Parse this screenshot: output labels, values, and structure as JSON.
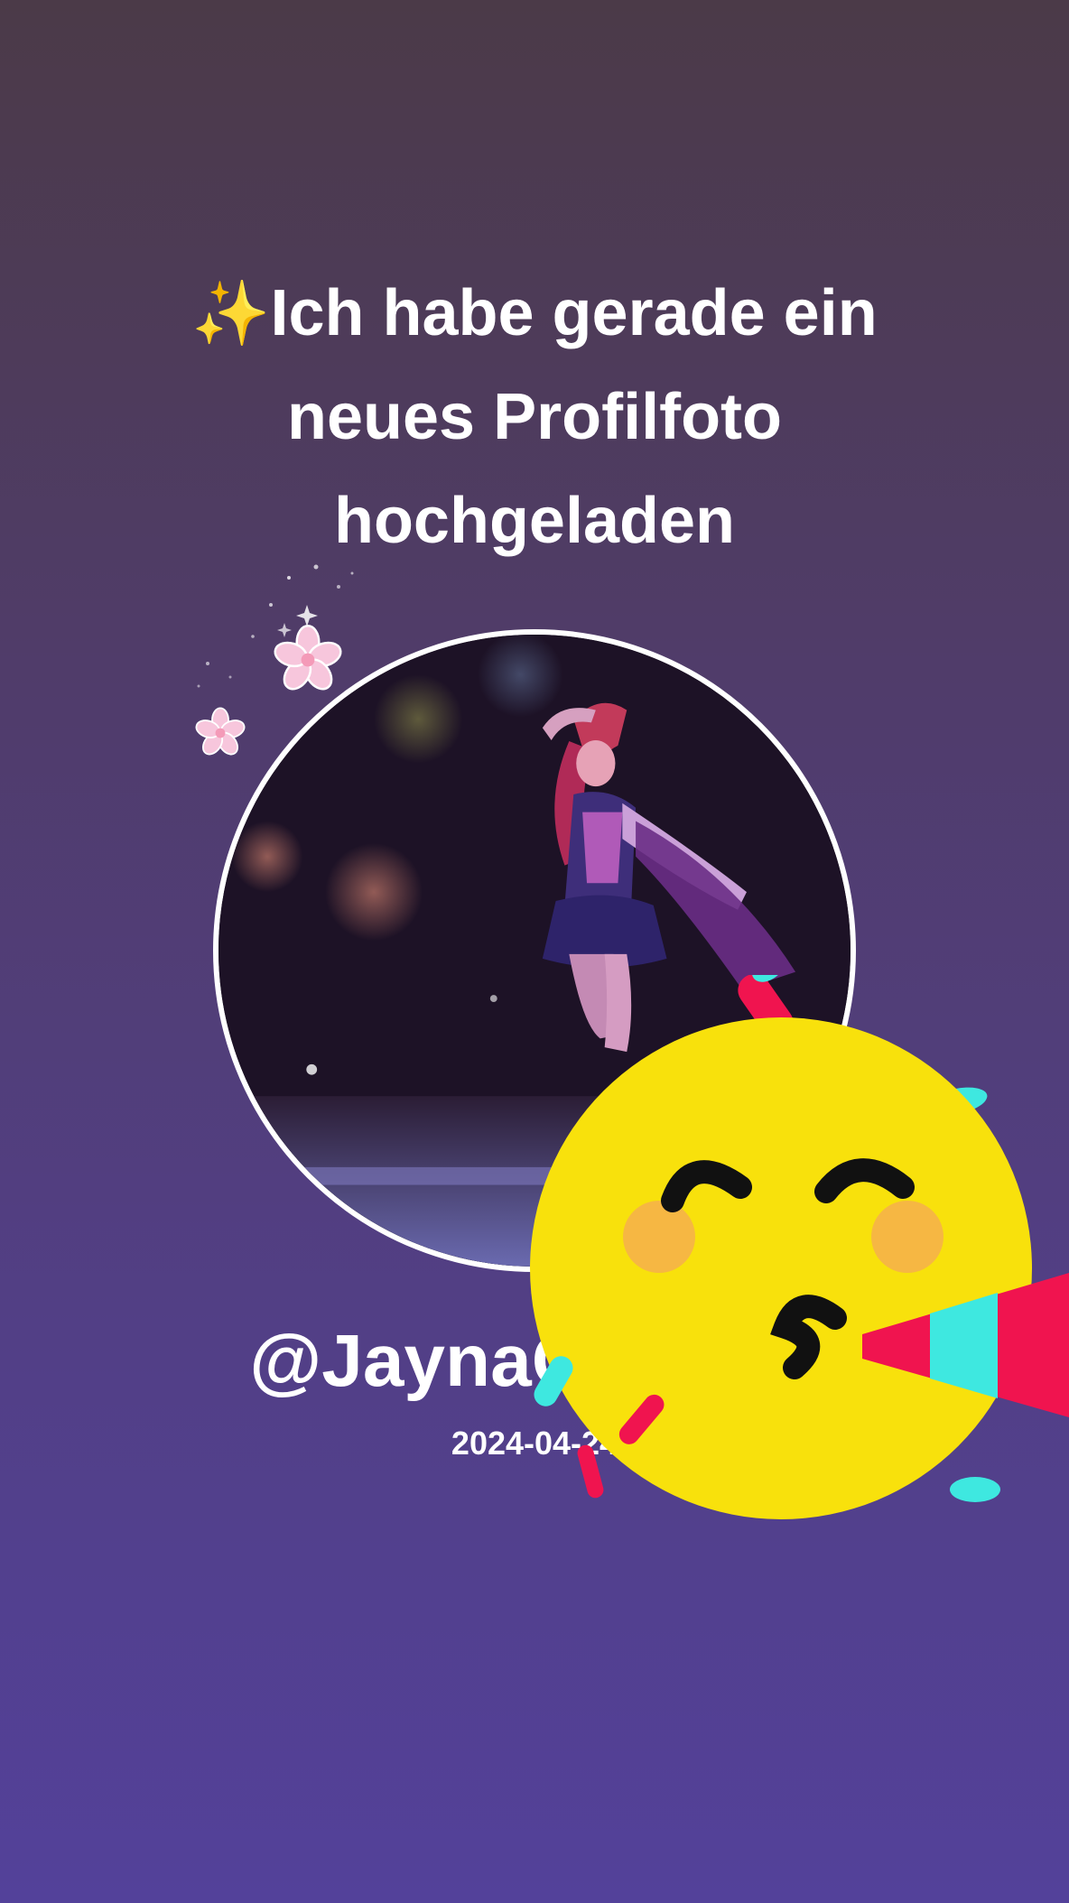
{
  "announcement": {
    "emoji": "✨",
    "line1": "Ich habe gerade ein",
    "line2": "neues Profilfoto",
    "line3": "hochgeladen"
  },
  "profile": {
    "username": "@JaynaCosplay",
    "date": "2024-04-24"
  },
  "decorations": {
    "flower_icon": "cherry-blossom",
    "party_icon": "partying-face-with-horn",
    "colors": {
      "background_top": "#4b3a48",
      "background_bottom": "#53419a",
      "emoji_yellow": "#f8e10c",
      "confetti_cyan": "#3ee8e0",
      "confetti_pink": "#f0144f"
    }
  }
}
